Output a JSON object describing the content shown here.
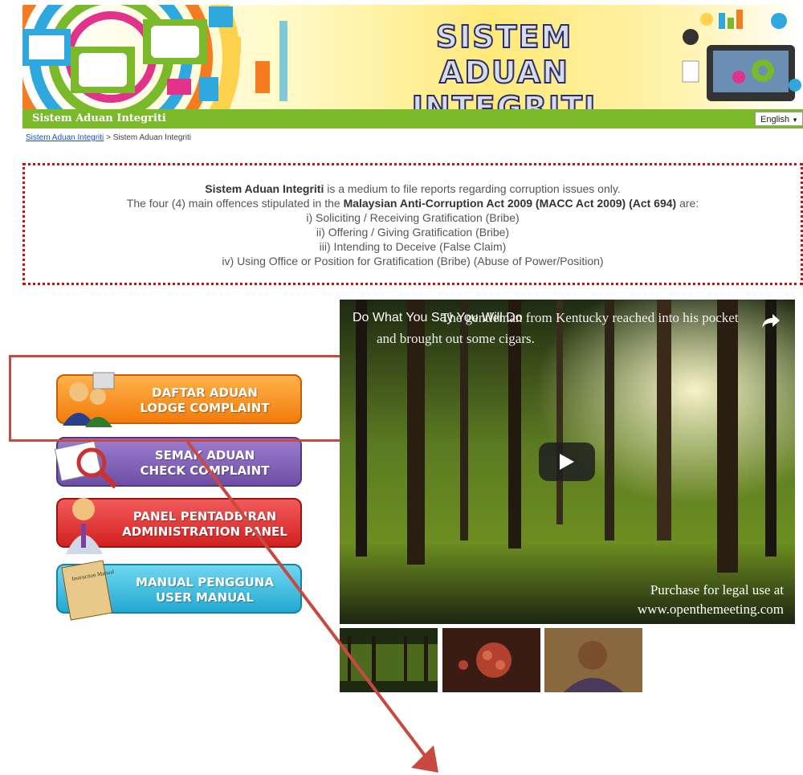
{
  "header": {
    "title_line1": "SISTEM",
    "title_line2": "ADUAN INTEGRITI",
    "site_name": "Sistem Aduan Integriti",
    "language": "English"
  },
  "breadcrumb": {
    "link": "Sistem Aduan Integriti",
    "separator": ">",
    "current": "Sistem Aduan Integriti"
  },
  "info": {
    "line1_bold": "Sistem Aduan Integriti",
    "line1_rest": "is a medium to file reports regarding corruption issues only.",
    "line2_pre": "The four (4) main offences stipulated in the",
    "line2_bold": "Malaysian Anti-Corruption Act 2009 (MACC Act 2009) (Act 694)",
    "line2_post": "are:",
    "offences": [
      "i) Soliciting / Receiving Gratification (Bribe)",
      "ii) Offering / Giving Gratification (Bribe)",
      "iii) Intending to Deceive (False Claim)",
      "iv) Using Office or Position for Gratification (Bribe) (Abuse of Power/Position)"
    ]
  },
  "menu": {
    "lodge": {
      "line1": "DAFTAR ADUAN",
      "line2": "LODGE COMPLAINT"
    },
    "check": {
      "line1": "SEMAK ADUAN",
      "line2": "CHECK COMPLAINT"
    },
    "admin": {
      "line1": "PANEL PENTADBIRAN",
      "line2": "ADMINISTRATION PANEL"
    },
    "manual": {
      "line1": "MANUAL PENGGUNA",
      "line2": "USER MANUAL",
      "book_label": "Instruction Manual"
    }
  },
  "video": {
    "title": "Do What You Say You Will Do",
    "overlay_text_1": "The gentleman from Kentucky reached into his pocket",
    "overlay_text_2": "and brought out some cigars.",
    "legal_line1": "Purchase for legal use at",
    "legal_line2": "www.openthemeeting.com"
  },
  "colors": {
    "green_bar": "#7ab92a",
    "lodge": "#f27b0c",
    "check": "#6d4fa5",
    "admin": "#d32121",
    "manual": "#24a9d2",
    "highlight": "#c8493f"
  }
}
